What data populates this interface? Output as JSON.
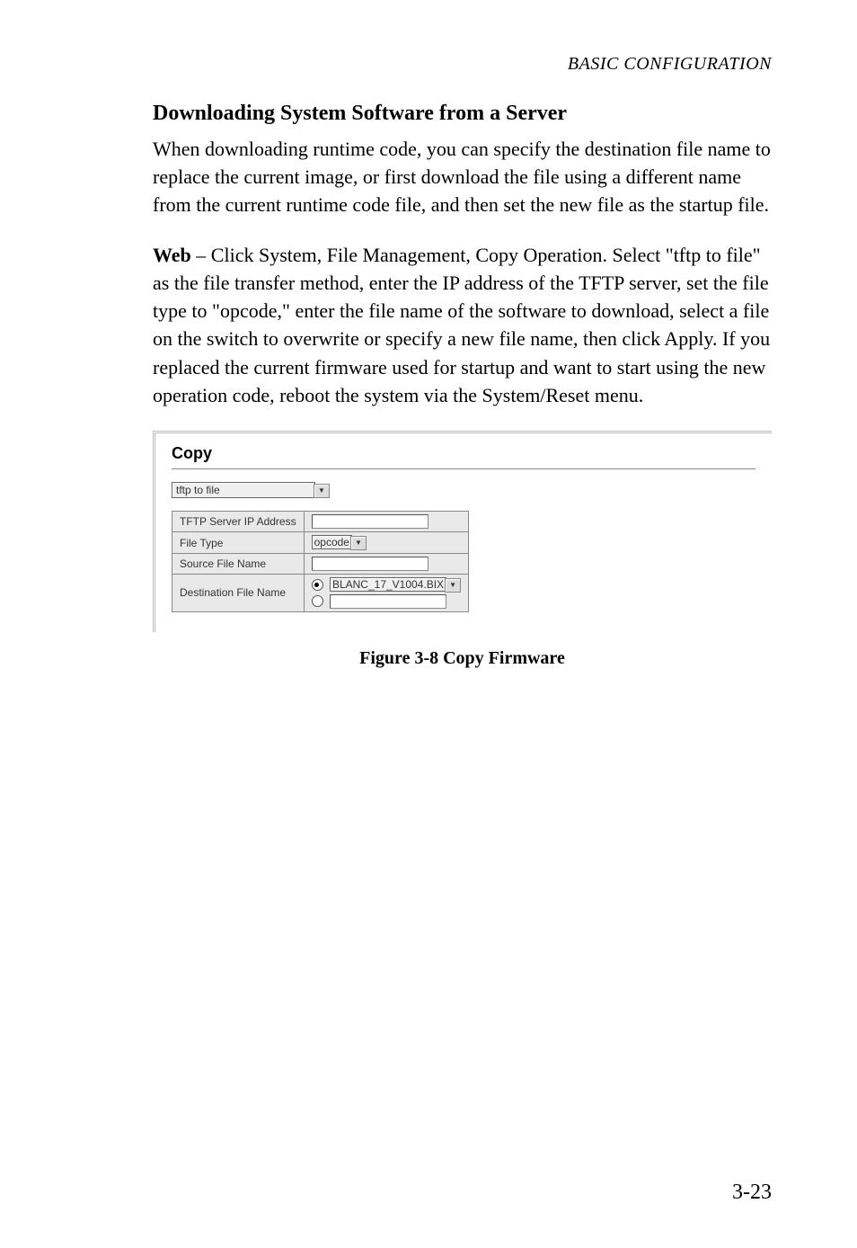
{
  "running_head": "BASIC CONFIGURATION",
  "heading": "Downloading System Software from a Server",
  "para1": "When downloading runtime code, you can specify the destination file name to replace the current image, or first download the file using a different name from the current runtime code file, and then set the new file as the startup file.",
  "para2_lead": "Web",
  "para2_rest": " – Click System, File Management, Copy Operation. Select \"tftp to file\" as the file transfer method, enter the IP address of the TFTP server, set the file type to \"opcode,\" enter the file name of the software to download, select a file on the switch to overwrite or specify a new file name, then click Apply. If you replaced the current firmware used for startup and want to start using the new operation code, reboot the system via the System/Reset menu.",
  "copy_panel": {
    "title": "Copy",
    "transfer_method": "tftp to file",
    "rows": {
      "server_label": "TFTP Server IP Address",
      "server_value": "",
      "filetype_label": "File Type",
      "filetype_value": "opcode",
      "source_label": "Source File Name",
      "source_value": "",
      "dest_label": "Destination File Name",
      "dest_select_value": "BLANC_17_V1004.BIX",
      "dest_text_value": ""
    }
  },
  "figure_caption": "Figure 3-8  Copy Firmware",
  "page_number": "3-23",
  "chart_data": {
    "type": "table",
    "title": "Copy",
    "select": {
      "label": "Transfer method",
      "value": "tftp to file"
    },
    "rows": [
      {
        "label": "TFTP Server IP Address",
        "control": "text",
        "value": ""
      },
      {
        "label": "File Type",
        "control": "select",
        "value": "opcode"
      },
      {
        "label": "Source File Name",
        "control": "text",
        "value": ""
      },
      {
        "label": "Destination File Name",
        "control": "radio-group",
        "options": [
          {
            "type": "select",
            "value": "BLANC_17_V1004.BIX",
            "selected": true
          },
          {
            "type": "text",
            "value": "",
            "selected": false
          }
        ]
      }
    ]
  }
}
